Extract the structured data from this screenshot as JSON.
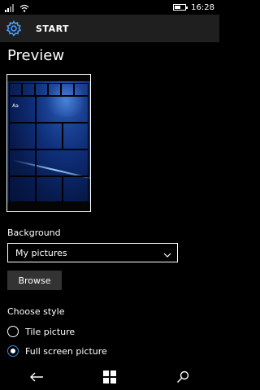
{
  "status_bar": {
    "time": "16:28",
    "battery_level": 0.6,
    "icons": [
      "signal-icon",
      "wifi-icon",
      "battery-icon"
    ]
  },
  "app_bar": {
    "title": "START",
    "icon": "gear-icon"
  },
  "page": {
    "title": "Preview"
  },
  "preview": {
    "tile_label": "Aa"
  },
  "background": {
    "label": "Background",
    "selected": "My pictures",
    "browse_label": "Browse"
  },
  "style": {
    "label": "Choose style",
    "options": [
      {
        "label": "Tile picture",
        "selected": false
      },
      {
        "label": "Full screen picture",
        "selected": true
      }
    ]
  },
  "colors": {
    "accent": "#2f8fe6",
    "appbar": "#1f1f1f",
    "button": "#333333"
  },
  "nav": [
    "back-icon",
    "windows-icon",
    "search-icon"
  ]
}
